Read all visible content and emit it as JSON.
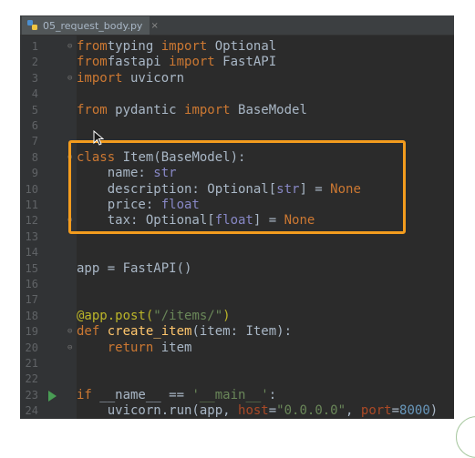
{
  "tab": {
    "file_name": "05_request_body.py",
    "close_label": "×"
  },
  "lines": [
    {
      "n": "1",
      "fold": true,
      "run": false,
      "tokens": [
        [
          "kw",
          "from"
        ],
        [
          "",
          "typing "
        ],
        [
          "kw",
          "import"
        ],
        [
          "",
          " Optional"
        ]
      ]
    },
    {
      "n": "2",
      "fold": false,
      "run": false,
      "tokens": [
        [
          "kw",
          "from"
        ],
        [
          "",
          "fastapi "
        ],
        [
          "kw",
          "import"
        ],
        [
          "",
          " FastAPI"
        ]
      ]
    },
    {
      "n": "3",
      "fold": true,
      "run": false,
      "tokens": [
        [
          "kw",
          "import"
        ],
        [
          "",
          " uvicorn"
        ]
      ]
    },
    {
      "n": "4",
      "fold": false,
      "run": false,
      "tokens": []
    },
    {
      "n": "5",
      "fold": false,
      "run": false,
      "tokens": [
        [
          "kw",
          "from"
        ],
        [
          "",
          " pydantic "
        ],
        [
          "kw",
          "import"
        ],
        [
          "",
          " BaseModel"
        ]
      ]
    },
    {
      "n": "6",
      "fold": false,
      "run": false,
      "tokens": []
    },
    {
      "n": "7",
      "fold": false,
      "run": false,
      "tokens": []
    },
    {
      "n": "8",
      "fold": true,
      "run": false,
      "tokens": [
        [
          "kw",
          "class"
        ],
        [
          "",
          " Item(BaseModel):"
        ]
      ]
    },
    {
      "n": "9",
      "fold": false,
      "run": false,
      "tokens": [
        [
          "",
          "    name: "
        ],
        [
          "bi",
          "str"
        ]
      ]
    },
    {
      "n": "10",
      "fold": false,
      "run": false,
      "tokens": [
        [
          "",
          "    description: Optional["
        ],
        [
          "bi",
          "str"
        ],
        [
          "",
          "] = "
        ],
        [
          "kw",
          "None"
        ]
      ]
    },
    {
      "n": "11",
      "fold": false,
      "run": false,
      "tokens": [
        [
          "",
          "    price: "
        ],
        [
          "bi",
          "float"
        ]
      ]
    },
    {
      "n": "12",
      "fold": true,
      "run": false,
      "tokens": [
        [
          "",
          "    tax: Optional["
        ],
        [
          "bi",
          "float"
        ],
        [
          "",
          "] = "
        ],
        [
          "kw",
          "None"
        ]
      ]
    },
    {
      "n": "13",
      "fold": false,
      "run": false,
      "tokens": []
    },
    {
      "n": "14",
      "fold": false,
      "run": false,
      "tokens": []
    },
    {
      "n": "15",
      "fold": false,
      "run": false,
      "tokens": [
        [
          "",
          "app = FastAPI()"
        ]
      ]
    },
    {
      "n": "16",
      "fold": false,
      "run": false,
      "tokens": []
    },
    {
      "n": "17",
      "fold": false,
      "run": false,
      "tokens": []
    },
    {
      "n": "18",
      "fold": false,
      "run": false,
      "tokens": [
        [
          "deco",
          "@app.post("
        ],
        [
          "str",
          "\"/items/\""
        ],
        [
          "deco",
          ")"
        ]
      ]
    },
    {
      "n": "19",
      "fold": true,
      "run": false,
      "tokens": [
        [
          "kw",
          "def"
        ],
        [
          " fn",
          " create_item"
        ],
        [
          "",
          "(item: Item):"
        ]
      ]
    },
    {
      "n": "20",
      "fold": true,
      "run": false,
      "tokens": [
        [
          "",
          "    "
        ],
        [
          "kw",
          "return"
        ],
        [
          "",
          " item"
        ]
      ]
    },
    {
      "n": "21",
      "fold": false,
      "run": false,
      "tokens": []
    },
    {
      "n": "22",
      "fold": false,
      "run": false,
      "tokens": []
    },
    {
      "n": "23",
      "fold": false,
      "run": true,
      "tokens": [
        [
          "kw",
          "if"
        ],
        [
          "",
          " __name__ == "
        ],
        [
          "str",
          "'__main__'"
        ],
        [
          "",
          ":"
        ]
      ]
    },
    {
      "n": "24",
      "fold": false,
      "run": false,
      "tokens": [
        [
          "",
          "    uvicorn.run(app, "
        ],
        [
          "kwarg",
          "host"
        ],
        [
          "",
          "="
        ],
        [
          "str",
          "\"0.0.0.0\""
        ],
        [
          "",
          ", "
        ],
        [
          "kwarg",
          "port"
        ],
        [
          "",
          "="
        ],
        [
          "num",
          "8000"
        ],
        [
          "",
          ")"
        ]
      ]
    }
  ],
  "highlight_color": "#f39c1e"
}
